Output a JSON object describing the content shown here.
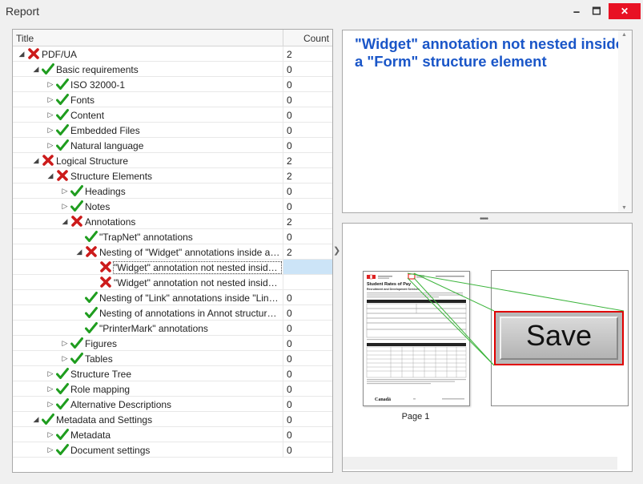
{
  "window": {
    "title": "Report",
    "min_glyph": "🗕",
    "max_glyph": "🗖",
    "close_glyph": "✕"
  },
  "tree": {
    "col_title": "Title",
    "col_count": "Count",
    "rows": [
      {
        "label": "PDF/UA",
        "count": "2",
        "status": "fail",
        "level": 0,
        "expand": "open"
      },
      {
        "label": "Basic requirements",
        "count": "0",
        "status": "pass",
        "level": 1,
        "expand": "open"
      },
      {
        "label": "ISO 32000-1",
        "count": "0",
        "status": "pass",
        "level": 2,
        "expand": "closed"
      },
      {
        "label": "Fonts",
        "count": "0",
        "status": "pass",
        "level": 2,
        "expand": "closed"
      },
      {
        "label": "Content",
        "count": "0",
        "status": "pass",
        "level": 2,
        "expand": "closed"
      },
      {
        "label": "Embedded Files",
        "count": "0",
        "status": "pass",
        "level": 2,
        "expand": "closed"
      },
      {
        "label": "Natural language",
        "count": "0",
        "status": "pass",
        "level": 2,
        "expand": "closed"
      },
      {
        "label": "Logical Structure",
        "count": "2",
        "status": "fail",
        "level": 1,
        "expand": "open"
      },
      {
        "label": "Structure Elements",
        "count": "2",
        "status": "fail",
        "level": 2,
        "expand": "open"
      },
      {
        "label": "Headings",
        "count": "0",
        "status": "pass",
        "level": 3,
        "expand": "closed"
      },
      {
        "label": "Notes",
        "count": "0",
        "status": "pass",
        "level": 3,
        "expand": "closed"
      },
      {
        "label": "Annotations",
        "count": "2",
        "status": "fail",
        "level": 3,
        "expand": "open"
      },
      {
        "label": "\"TrapNet\" annotations",
        "count": "0",
        "status": "pass",
        "level": 4,
        "expand": "none"
      },
      {
        "label": "Nesting of \"Widget\" annotations inside a \"F...",
        "count": "2",
        "status": "fail",
        "level": 4,
        "expand": "open"
      },
      {
        "label": "\"Widget\" annotation not nested inside a...",
        "count": "",
        "status": "fail",
        "level": 5,
        "expand": "none",
        "selected": true
      },
      {
        "label": "\"Widget\" annotation not nested inside a...",
        "count": "",
        "status": "fail",
        "level": 5,
        "expand": "none"
      },
      {
        "label": "Nesting of \"Link\" annotations inside \"Link\" st...",
        "count": "0",
        "status": "pass",
        "level": 4,
        "expand": "none"
      },
      {
        "label": "Nesting of annotations in Annot structure el...",
        "count": "0",
        "status": "pass",
        "level": 4,
        "expand": "none"
      },
      {
        "label": "\"PrinterMark\" annotations",
        "count": "0",
        "status": "pass",
        "level": 4,
        "expand": "none"
      },
      {
        "label": "Figures",
        "count": "0",
        "status": "pass",
        "level": 3,
        "expand": "closed"
      },
      {
        "label": "Tables",
        "count": "0",
        "status": "pass",
        "level": 3,
        "expand": "closed"
      },
      {
        "label": "Structure Tree",
        "count": "0",
        "status": "pass",
        "level": 2,
        "expand": "closed"
      },
      {
        "label": "Role mapping",
        "count": "0",
        "status": "pass",
        "level": 2,
        "expand": "closed"
      },
      {
        "label": "Alternative Descriptions",
        "count": "0",
        "status": "pass",
        "level": 2,
        "expand": "closed"
      },
      {
        "label": "Metadata and Settings",
        "count": "0",
        "status": "pass",
        "level": 1,
        "expand": "open"
      },
      {
        "label": "Metadata",
        "count": "0",
        "status": "pass",
        "level": 2,
        "expand": "closed"
      },
      {
        "label": "Document settings",
        "count": "0",
        "status": "pass",
        "level": 2,
        "expand": "closed"
      }
    ]
  },
  "message": {
    "text": "\"Widget\" annotation not nested inside a \"Form\" structure element",
    "color": "#1a56c8"
  },
  "preview": {
    "page_caption": "Page 1",
    "zoom_label": "Save",
    "page_title": "Student Rates of Pay",
    "page_subtitle": "Recruitment and Development Services",
    "footer_logo": "Canadä"
  },
  "colors": {
    "pass": "#1f9d1f",
    "fail": "#cc1b1b",
    "highlight": "#e00000",
    "link_lines": "#3cb43c"
  }
}
